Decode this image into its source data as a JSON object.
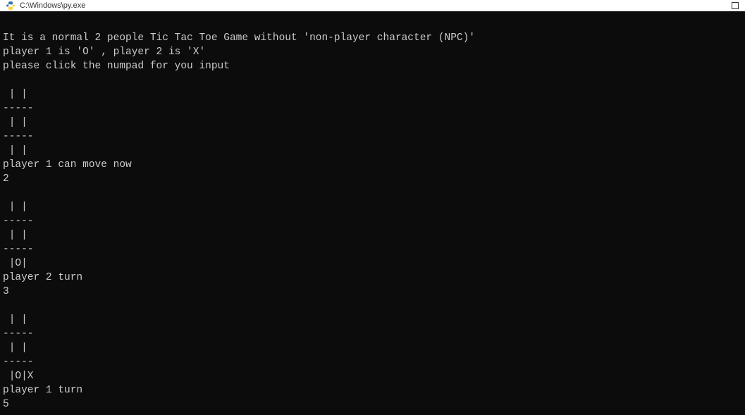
{
  "titleBar": {
    "title": "C:\\Windows\\py.exe"
  },
  "console": {
    "lines": [
      "",
      "It is a normal 2 people Tic Tac Toe Game without 'non-player character (NPC)'",
      "player 1 is 'O' , player 2 is 'X'",
      "please click the numpad for you input",
      "",
      " | |",
      "-----",
      " | |",
      "-----",
      " | |",
      "player 1 can move now",
      "2",
      "",
      " | |",
      "-----",
      " | |",
      "-----",
      " |O|",
      "player 2 turn",
      "3",
      "",
      " | |",
      "-----",
      " | |",
      "-----",
      " |O|X",
      "player 1 turn",
      "5"
    ]
  }
}
